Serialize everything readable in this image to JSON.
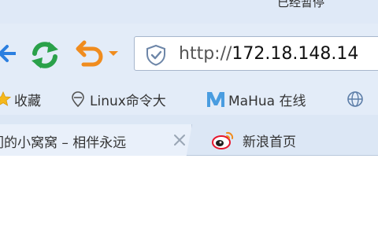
{
  "window": {
    "title_fragment": "已经暂停"
  },
  "navigation": {
    "back_icon": "back-arrow-icon",
    "refresh_icon": "refresh-icon",
    "undo_icon": "undo-icon",
    "undo_dropdown_icon": "chevron-down-icon",
    "address": {
      "security_icon": "shield-icon",
      "protocol": "http://",
      "host": "172.18.148.14"
    }
  },
  "bookmarks": [
    {
      "label": "收藏",
      "icon": "star-icon"
    },
    {
      "label": "Linux命令大",
      "icon": "bookmark-icon"
    },
    {
      "label": "MaHua 在线",
      "icon": "mahua-logo-icon"
    },
    {
      "label": "",
      "icon": "globe-icon"
    }
  ],
  "tabs": [
    {
      "label": "们的小窝窝 – 相伴永远",
      "active": true,
      "close_icon": "close-icon"
    },
    {
      "label": "新浪首页",
      "icon": "weibo-icon",
      "active": false
    }
  ],
  "colors": {
    "toolbar_bg": "#e3ecf8",
    "accent_blue": "#2b7fe0",
    "refresh_green": "#2aa14a",
    "undo_orange": "#f08c1e",
    "weibo_red": "#e6162d"
  }
}
